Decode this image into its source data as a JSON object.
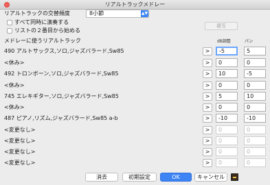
{
  "window": {
    "title": "リアルトラックメドレー"
  },
  "settings": {
    "frequency_label": "リアルトラックの交替頻度",
    "frequency_value": "8小節",
    "play_all_label": "すべて同時に演奏する",
    "start_second_label": "リストの２番目から始める",
    "copy_label": "複写"
  },
  "list": {
    "heading": "メドレーに使うリアルトラック",
    "col_db": "dB調整",
    "col_pan": "パン",
    "rows": [
      {
        "name": "490 アルトサックス,ソロ,ジャズバラード,Sw85",
        "db": "-5",
        "pan": "5"
      },
      {
        "name": "<休み>",
        "db": "0",
        "pan": "0"
      },
      {
        "name": "492 トロンボーン,ソロ,ジャズバラード,Sw85",
        "db": "10",
        "pan": "-5"
      },
      {
        "name": "<休み>",
        "db": "0",
        "pan": "0"
      },
      {
        "name": "745 エレキギター,ソロ,ジャズバラード,Sw85",
        "db": "5",
        "pan": "10"
      },
      {
        "name": "<休み>",
        "db": "0",
        "pan": "0"
      },
      {
        "name": "487 ピアノ,リズム,ジャズバラード,Sw85 a-b",
        "db": "-10",
        "pan": "-10"
      },
      {
        "name": "<変更なし>",
        "db": "0",
        "pan": "0"
      },
      {
        "name": "<変更なし>",
        "db": "0",
        "pan": "0"
      },
      {
        "name": "<変更なし>",
        "db": "0",
        "pan": "0"
      },
      {
        "name": "<変更なし>",
        "db": "0",
        "pan": "0"
      }
    ],
    "arrow_label": ">"
  },
  "buttons": {
    "clear": "消去",
    "defaults": "初期設定",
    "ok": "OK",
    "cancel": "キャンセル"
  },
  "colors": {
    "accent": "#3d84f5",
    "close": "#f25f58"
  }
}
